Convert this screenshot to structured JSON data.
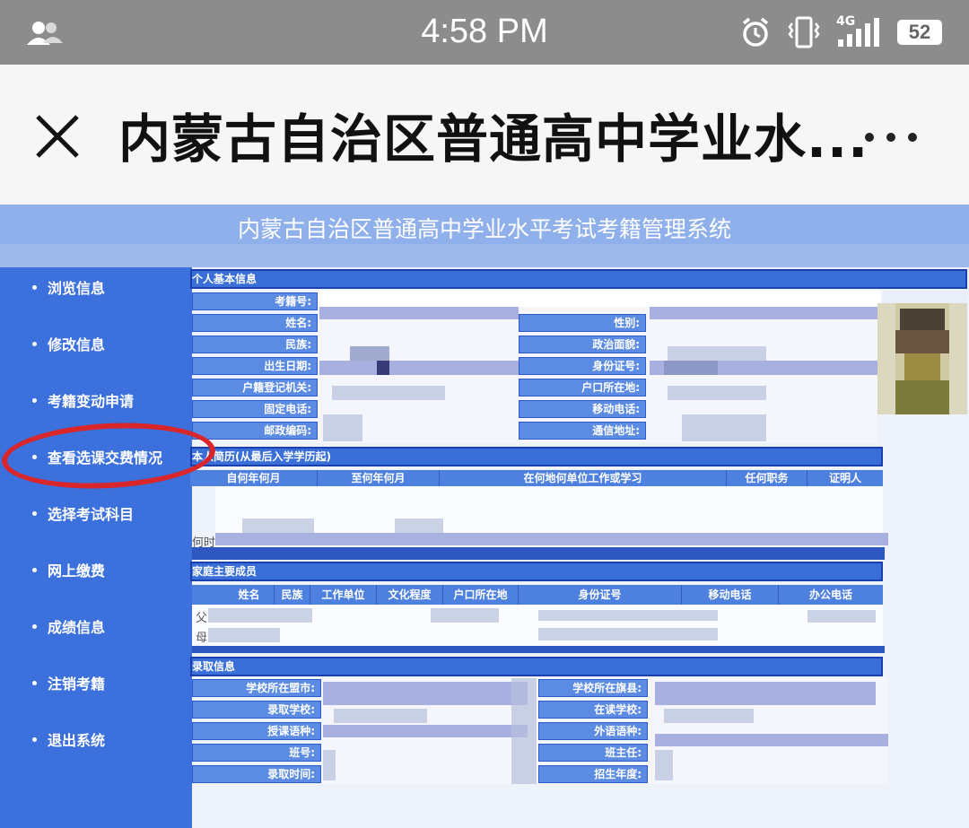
{
  "status_bar": {
    "time": "4:58 PM",
    "network": "4G",
    "battery": "52"
  },
  "title_bar": {
    "title": "内蒙古自治区普通高中学业水..."
  },
  "system": {
    "title": "内蒙古自治区普通高中学业水平考试考籍管理系统"
  },
  "sidebar": {
    "items": [
      {
        "label": "浏览信息"
      },
      {
        "label": "修改信息"
      },
      {
        "label": "考籍变动申请"
      },
      {
        "label": "查看选课交费情况"
      },
      {
        "label": "选择考试科目"
      },
      {
        "label": "网上缴费"
      },
      {
        "label": "成绩信息"
      },
      {
        "label": "注销考籍"
      },
      {
        "label": "退出系统"
      }
    ]
  },
  "basic_info": {
    "section": "个人基本信息",
    "left_labels": [
      "考籍号:",
      "姓名:",
      "民族:",
      "出生日期:",
      "户籍登记机关:",
      "固定电话:",
      "邮政编码:"
    ],
    "right_labels": [
      "性别:",
      "政治面貌:",
      "身份证号:",
      "户口所在地:",
      "移动电话:",
      "通信地址:"
    ]
  },
  "resume": {
    "section": "本人简历(从最后入学学历起)",
    "columns": [
      "自何年何月",
      "至何年何月",
      "在何地何单位工作或学习",
      "任何职务",
      "证明人"
    ],
    "fragment": "何时"
  },
  "family": {
    "section": "家庭主要成员",
    "columns": [
      "姓名",
      "民族",
      "工作单位",
      "文化程度",
      "户口所在地",
      "身份证号",
      "移动电话",
      "办公电话"
    ],
    "rows": [
      "父",
      "母"
    ]
  },
  "admission": {
    "section": "录取信息",
    "left_labels": [
      "学校所在盟市:",
      "录取学校:",
      "授课语种:",
      "班号:",
      "录取时间:"
    ],
    "right_labels": [
      "学校所在旗县:",
      "在读学校:",
      "外语语种:",
      "班主任:",
      "招生年度:"
    ]
  },
  "colors": {
    "sidebar": "#3b70dd",
    "header": "#8fb0ea",
    "highlight_circle": "#d8262b"
  }
}
